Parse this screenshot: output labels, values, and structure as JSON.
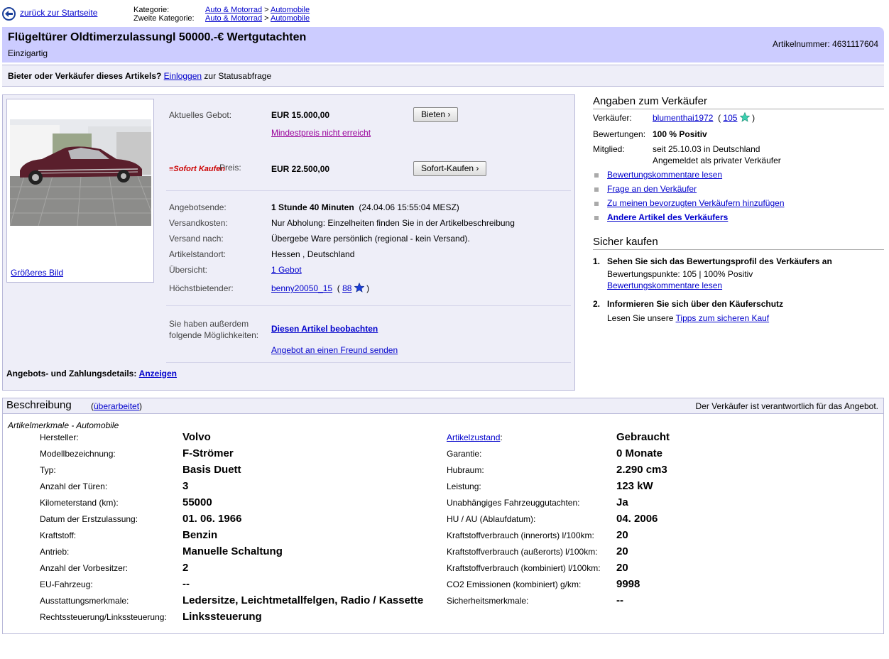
{
  "nav": {
    "back_label": "zurück zur Startseite",
    "category_label": "Kategorie:",
    "second_category_label": "Zweite Kategorie:",
    "category_1": "Auto & Motorrad",
    "category_2": "Automobile",
    "separator": ">"
  },
  "header": {
    "title": "Flügeltürer Oldtimerzulassungl 50000.-€ Wertgutachten",
    "subtitle": "Einzigartig",
    "item_number": "Artikelnummer: 4631117604"
  },
  "login": {
    "prefix": "Bieter oder Verkäufer dieses Artikels?",
    "link": "Einloggen",
    "suffix": "zur Statusabfrage"
  },
  "item": {
    "bigger_image": "Größeres Bild",
    "current_bid_label": "Aktuelles Gebot:",
    "current_bid": "EUR 15.000,00",
    "bid_button": "Bieten",
    "reserve_not_met": "Mindestpreis nicht erreicht",
    "buy_now_logo": "Sofort Kaufen",
    "price_label": "Preis:",
    "price": "EUR 22.500,00",
    "buy_now_button": "Sofort-Kaufen",
    "end_label": "Angebotsende:",
    "end_remaining": "1 Stunde 40 Minuten",
    "end_date": "(24.04.06 15:55:04 MESZ)",
    "shipping_label": "Versandkosten:",
    "shipping": "Nur Abholung: Einzelheiten finden Sie in der Artikelbeschreibung",
    "ship_to_label": "Versand nach:",
    "ship_to": "Übergebe Ware persönlich (regional - kein Versand).",
    "location_label": "Artikelstandort:",
    "location": "Hessen , Deutschland",
    "overview_label": "Übersicht:",
    "overview": "1 Gebot",
    "high_bidder_label": "Höchstbietender:",
    "high_bidder": "benny20050_15",
    "high_bidder_score": "88",
    "options_label_1": "Sie haben außerdem",
    "options_label_2": "folgende Möglichkeiten:",
    "watch": "Diesen Artikel beobachten",
    "send_friend": "Angebot an einen Freund senden",
    "payment_label": "Angebots- und Zahlungsdetails:",
    "payment_link": "Anzeigen"
  },
  "seller": {
    "heading": "Angaben zum Verkäufer",
    "seller_label": "Verkäufer:",
    "seller_name": "blumenthai1972",
    "seller_score": "105",
    "rating_label": "Bewertungen:",
    "rating": "100 % Positiv",
    "member_label": "Mitglied:",
    "member_since": "seit 25.10.03 in Deutschland",
    "member_type": "Angemeldet als privater Verkäufer",
    "links": [
      "Bewertungskommentare lesen",
      "Frage an den Verkäufer",
      "Zu meinen bevorzugten Verkäufern hinzufügen",
      "Andere Artikel des Verkäufers"
    ]
  },
  "safe": {
    "heading": "Sicher kaufen",
    "step1_num": "1.",
    "step1_title": "Sehen Sie sich das Bewertungsprofil des Verkäufers an",
    "step1_points": "Bewertungspunkte: 105 | 100% Positiv",
    "step1_link": "Bewertungskommentare lesen",
    "step2_num": "2.",
    "step2_title": "Informieren Sie sich über den Käuferschutz",
    "step2_prefix": "Lesen Sie unsere",
    "step2_link": "Tipps zum sicheren Kauf"
  },
  "description": {
    "heading": "Beschreibung",
    "edited": "überarbeitet",
    "responsible": "Der Verkäufer ist verantwortlich für das Angebot.",
    "attributes_title": "Artikelmerkmale - Automobile",
    "left": [
      {
        "label": "Hersteller:",
        "value": "Volvo"
      },
      {
        "label": "Modellbezeichnung:",
        "value": "F-Strömer"
      },
      {
        "label": "Typ:",
        "value": "Basis Duett"
      },
      {
        "label": "Anzahl der Türen:",
        "value": "3"
      },
      {
        "label": "Kilometerstand (km):",
        "value": "55000"
      },
      {
        "label": "Datum der Erstzulassung:",
        "value": "01. 06. 1966"
      },
      {
        "label": "Kraftstoff:",
        "value": "Benzin"
      },
      {
        "label": "Antrieb:",
        "value": "Manuelle Schaltung"
      },
      {
        "label": "Anzahl der Vorbesitzer:",
        "value": "2"
      },
      {
        "label": "EU-Fahrzeug:",
        "value": "--"
      },
      {
        "label": "Ausstattungsmerkmale:",
        "value": "Ledersitze, Leichtmetallfelgen, Radio / Kassette"
      },
      {
        "label": "Rechtssteuerung/Linkssteuerung:",
        "value": "Linkssteuerung"
      }
    ],
    "right": [
      {
        "label": "Artikelzustand",
        "value": "Gebraucht"
      },
      {
        "label": "Garantie:",
        "value": "0 Monate"
      },
      {
        "label": "Hubraum:",
        "value": "2.290 cm3"
      },
      {
        "label": "Leistung:",
        "value": "123 kW"
      },
      {
        "label": "Unabhängiges Fahrzeuggutachten:",
        "value": "Ja"
      },
      {
        "label": "HU / AU (Ablaufdatum):",
        "value": "04. 2006"
      },
      {
        "label": "Kraftstoffverbrauch (innerorts) l/100km:",
        "value": "20"
      },
      {
        "label": "Kraftstoffverbrauch (außerorts) l/100km:",
        "value": "20"
      },
      {
        "label": "Kraftstoffverbrauch (kombiniert) l/100km:",
        "value": "20"
      },
      {
        "label": "CO2 Emissionen (kombiniert) g/km:",
        "value": "9998"
      },
      {
        "label": "Sicherheitsmerkmale:",
        "value": "--"
      }
    ]
  },
  "colors": {
    "title_bar": "#ccccff",
    "panel": "#eeeef8",
    "link": "#0000cc",
    "reserve_link": "#990099"
  }
}
